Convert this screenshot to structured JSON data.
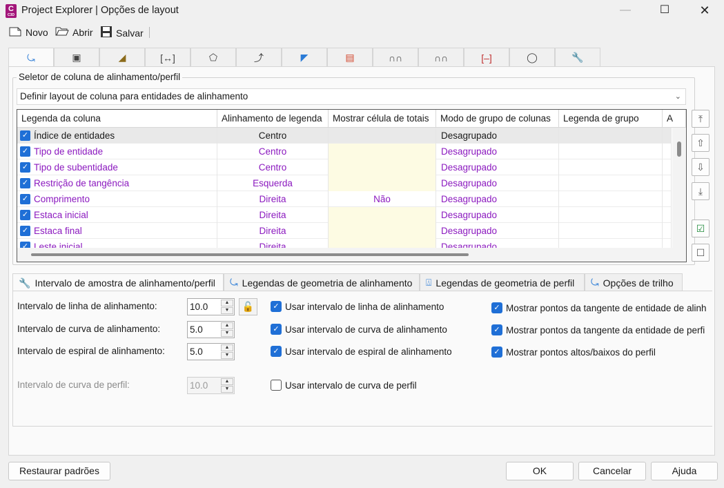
{
  "window": {
    "title": "Project Explorer | Opções de layout",
    "app_icon_letter": "C",
    "app_icon_sub": "C3D"
  },
  "toolbar": {
    "new_label": "Novo",
    "open_label": "Abrir",
    "save_label": "Salvar"
  },
  "top_tabs": [
    {
      "icon": "alignment-icon",
      "active": true
    },
    {
      "icon": "bridge-icon"
    },
    {
      "icon": "road-icon"
    },
    {
      "icon": "dimension-icon"
    },
    {
      "icon": "parcel-icon"
    },
    {
      "icon": "profile-icon"
    },
    {
      "icon": "corridor-icon"
    },
    {
      "icon": "surface-icon"
    },
    {
      "icon": "pipe-network-icon"
    },
    {
      "icon": "pressure-network-icon"
    },
    {
      "icon": "section-icon"
    },
    {
      "icon": "view-frame-icon"
    },
    {
      "icon": "wrench-icon"
    }
  ],
  "selector": {
    "group_title": "Seletor de coluna de alinhamento/perfil",
    "combo_value": "Definir layout de coluna para entidades de alinhamento"
  },
  "grid": {
    "headers": [
      "Legenda da coluna",
      "Alinhamento de legenda",
      "Mostrar célula de totais",
      "Modo de grupo de colunas",
      "Legenda de grupo",
      "A"
    ],
    "rows": [
      {
        "name": "Índice de entidades",
        "align": "Centro",
        "totals": "",
        "group_mode": "Desagrupado",
        "group_caption": ""
      },
      {
        "name": "Tipo de entidade",
        "align": "Centro",
        "totals": "",
        "group_mode": "Desagrupado",
        "group_caption": ""
      },
      {
        "name": "Tipo de subentidade",
        "align": "Centro",
        "totals": "",
        "group_mode": "Desagrupado",
        "group_caption": ""
      },
      {
        "name": "Restrição de tangência",
        "align": "Esquerda",
        "totals": "",
        "group_mode": "Desagrupado",
        "group_caption": ""
      },
      {
        "name": "Comprimento",
        "align": "Direita",
        "totals": "Não",
        "group_mode": "Desagrupado",
        "group_caption": ""
      },
      {
        "name": "Estaca inicial",
        "align": "Direita",
        "totals": "",
        "group_mode": "Desagrupado",
        "group_caption": ""
      },
      {
        "name": "Estaca final",
        "align": "Direita",
        "totals": "",
        "group_mode": "Desagrupado",
        "group_caption": ""
      },
      {
        "name": "Leste inicial",
        "align": "Direita",
        "totals": "",
        "group_mode": "Desagrupado",
        "group_caption": ""
      }
    ],
    "colors": {
      "editable_text": "#8b19bf",
      "yellow_cell": "#fdfbe3",
      "checkbox": "#1f6fd6"
    }
  },
  "side_buttons": [
    "move-to-top-icon",
    "move-up-icon",
    "move-down-icon",
    "move-to-bottom-icon",
    "check-all-icon",
    "uncheck-all-icon"
  ],
  "bottom_tabs": [
    {
      "label": "Intervalo de amostra de alinhamento/perfil",
      "icon": "wrench-icon",
      "active": true
    },
    {
      "label": "Legendas de geometria de alinhamento",
      "icon": "alignment-icon"
    },
    {
      "label": "Legendas de geometria de perfil",
      "icon": "profile-icon"
    },
    {
      "label": "Opções de trilho",
      "icon": "rail-icon"
    }
  ],
  "intervals": {
    "line_label": "Intervalo de linha de alinhamento:",
    "line_value": "10.0",
    "curve_label": "Intervalo de curva de alinhamento:",
    "curve_value": "5.0",
    "spiral_label": "Intervalo de espiral de alinhamento:",
    "spiral_value": "5.0",
    "profile_curve_label": "Intervalo de curva de perfil:",
    "profile_curve_value": "10.0"
  },
  "checks": {
    "use_line": "Usar intervalo de linha de alinhamento",
    "use_curve": "Usar intervalo de curva de alinhamento",
    "use_spiral": "Usar intervalo de espiral de alinhamento",
    "use_profile_curve": "Usar intervalo de curva de perfil",
    "show_tangent_align": "Mostrar pontos da tangente de entidade de alinh",
    "show_tangent_profile": "Mostrar pontos da tangente da entidade de perfi",
    "show_high_low": "Mostrar pontos altos/baixos do perfil"
  },
  "footer": {
    "restore_label": "Restaurar padrões",
    "ok_label": "OK",
    "cancel_label": "Cancelar",
    "help_label": "Ajuda"
  }
}
